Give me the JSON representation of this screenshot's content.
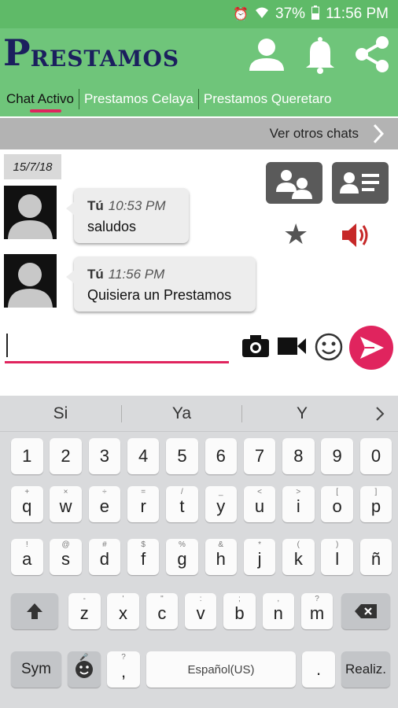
{
  "status_bar": {
    "battery": "37%",
    "time": "11:56 PM"
  },
  "app": {
    "logo_initial": "P",
    "logo_rest": "RESTAMOS",
    "icons": [
      "person-icon",
      "bell-icon",
      "share-icon"
    ]
  },
  "tabs": [
    "Chat Activo",
    "Prestamos Celaya",
    "Prestamos Queretaro"
  ],
  "other_chats": {
    "label": "Ver otros chats"
  },
  "chat": {
    "date": "15/7/18",
    "messages": [
      {
        "sender": "Tú",
        "time": "10:53 PM",
        "text": "saludos"
      },
      {
        "sender": "Tú",
        "time": "11:56 PM",
        "text": "Quisiera un Prestamos"
      }
    ]
  },
  "input": {
    "value": "",
    "placeholder": ""
  },
  "keyboard": {
    "suggestions": [
      "Si",
      "Ya",
      "Y"
    ],
    "number_row": [
      "1",
      "2",
      "3",
      "4",
      "5",
      "6",
      "7",
      "8",
      "9",
      "0"
    ],
    "row1": [
      {
        "k": "q",
        "h": "+"
      },
      {
        "k": "w",
        "h": "×"
      },
      {
        "k": "e",
        "h": "÷"
      },
      {
        "k": "r",
        "h": "="
      },
      {
        "k": "t",
        "h": "/"
      },
      {
        "k": "y",
        "h": "_"
      },
      {
        "k": "u",
        "h": "<"
      },
      {
        "k": "i",
        "h": ">"
      },
      {
        "k": "o",
        "h": "["
      },
      {
        "k": "p",
        "h": "]"
      }
    ],
    "row2": [
      {
        "k": "a",
        "h": "!"
      },
      {
        "k": "s",
        "h": "@"
      },
      {
        "k": "d",
        "h": "#"
      },
      {
        "k": "f",
        "h": "$"
      },
      {
        "k": "g",
        "h": "%"
      },
      {
        "k": "h",
        "h": "&"
      },
      {
        "k": "j",
        "h": "*"
      },
      {
        "k": "k",
        "h": "("
      },
      {
        "k": "l",
        "h": ")"
      },
      {
        "k": "ñ",
        "h": ""
      }
    ],
    "row3": [
      {
        "k": "z",
        "h": "-"
      },
      {
        "k": "x",
        "h": "'"
      },
      {
        "k": "c",
        "h": "\""
      },
      {
        "k": "v",
        "h": ":"
      },
      {
        "k": "b",
        "h": ";"
      },
      {
        "k": "n",
        "h": ","
      },
      {
        "k": "m",
        "h": "?"
      }
    ],
    "sym": "Sym",
    "comma": ",",
    "comma_hint": "?",
    "space": "Español(US)",
    "period": ".",
    "enter": "Realiz."
  }
}
